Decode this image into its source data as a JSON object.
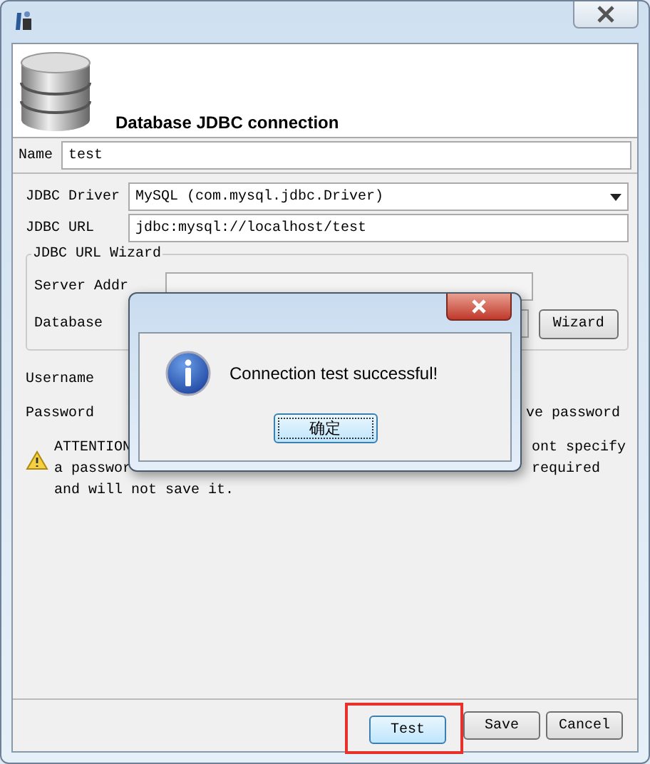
{
  "header": {
    "title": "Database JDBC connection"
  },
  "name_field": {
    "label": "Name",
    "value": "test"
  },
  "driver": {
    "label": "JDBC Driver",
    "value": "MySQL (com.mysql.jdbc.Driver)"
  },
  "url": {
    "label": "JDBC URL",
    "value": "jdbc:mysql://localhost/test"
  },
  "wizard": {
    "title": "JDBC URL Wizard",
    "server_label": "Server Addr",
    "database_label": "Database",
    "button": "Wizard"
  },
  "username": {
    "label": "Username"
  },
  "password": {
    "label": "Password",
    "save_password_label": "ve password"
  },
  "attention": {
    "left_lines": [
      "ATTENTION",
      "a passwor",
      "and will not save it."
    ],
    "right_lines": [
      "ont specify",
      "required"
    ]
  },
  "buttons": [
    {
      "label": "Test",
      "highlighted": true
    },
    {
      "label": "Save",
      "highlighted": false
    },
    {
      "label": "Cancel",
      "highlighted": false
    }
  ],
  "dialog": {
    "message": "Connection test successful!",
    "button": "确定"
  }
}
